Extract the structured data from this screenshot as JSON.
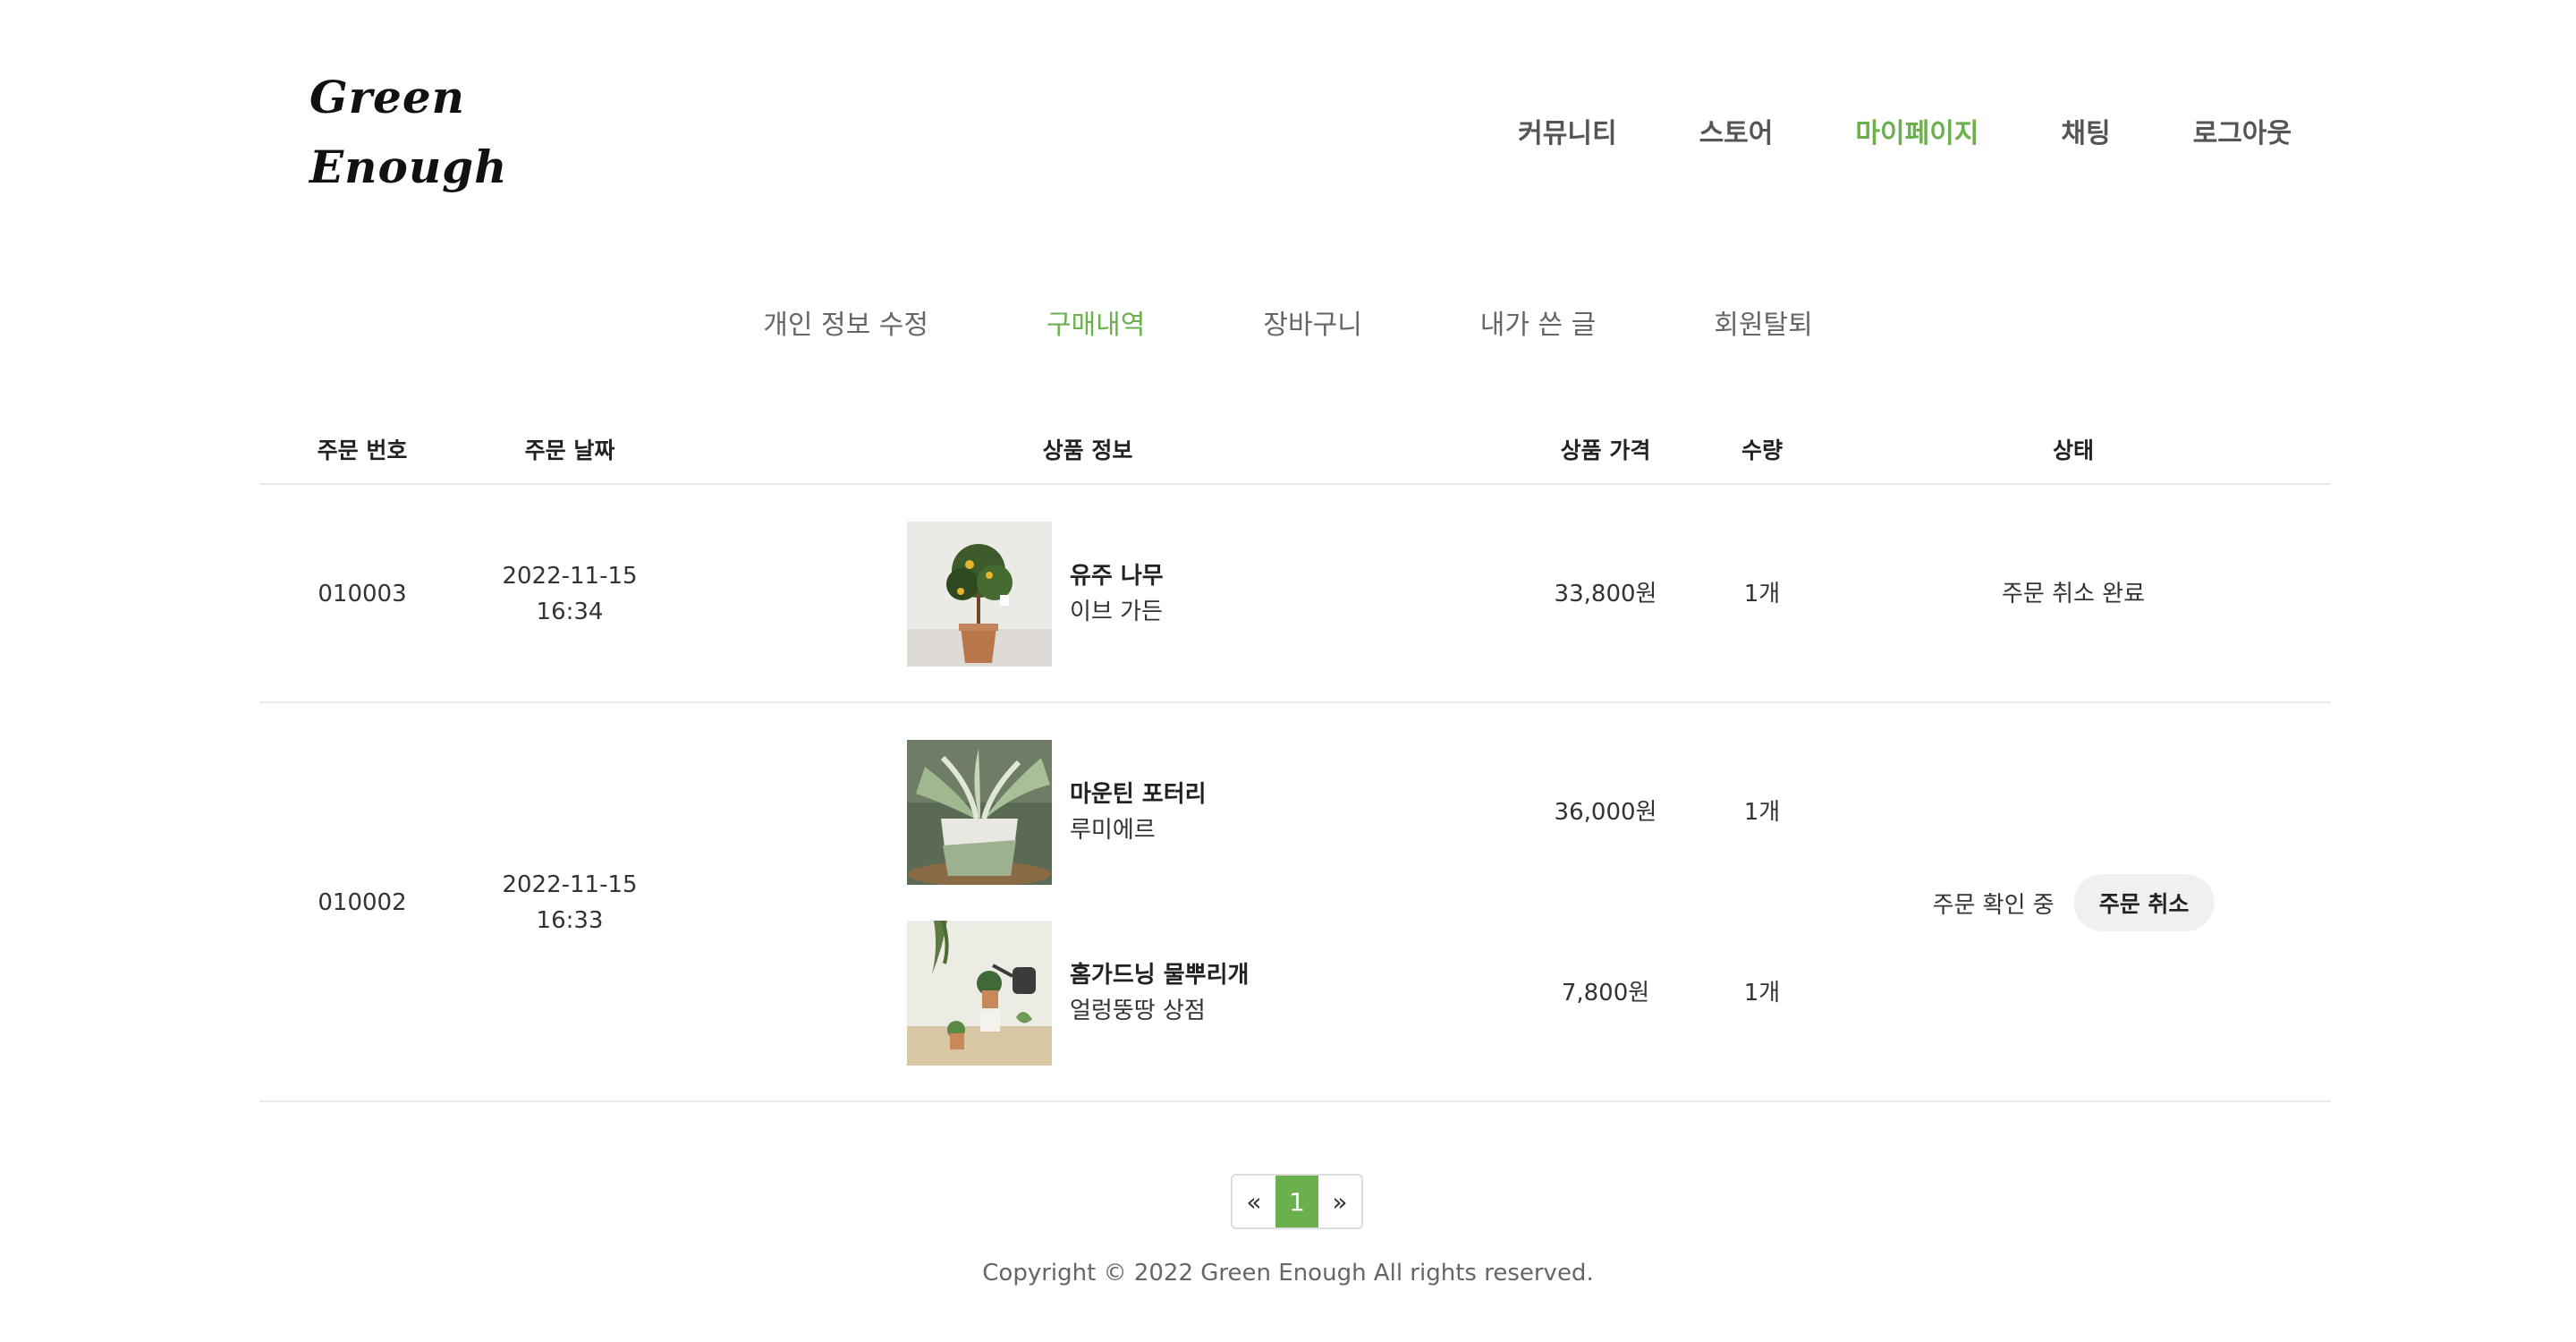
{
  "brand": {
    "line1": "Green",
    "line2": "Enough"
  },
  "main_nav": [
    "커뮤니티",
    "스토어",
    "마이페이지",
    "채팅",
    "로그아웃"
  ],
  "main_nav_active": "마이페이지",
  "sub_nav": [
    "개인 정보 수정",
    "구매내역",
    "장바구니",
    "내가 쓴 글",
    "회원탈퇴"
  ],
  "sub_nav_active": "구매내역",
  "table": {
    "headers": [
      "주문 번호",
      "주문 날짜",
      "상품 정보",
      "상품 가격",
      "수량",
      "상태"
    ],
    "orders": [
      {
        "order_no": "010003",
        "date": "2022-11-15",
        "time": "16:34",
        "items": [
          {
            "name": "유주 나무",
            "seller": "이브 가든",
            "price": "33,800원",
            "qty": "1개"
          }
        ],
        "status": "주문 취소 완료"
      },
      {
        "order_no": "010002",
        "date": "2022-11-15",
        "time": "16:33",
        "items": [
          {
            "name": "마운틴 포터리",
            "seller": "루미에르",
            "price": "36,000원",
            "qty": "1개"
          },
          {
            "name": "홈가드닝 물뿌리개",
            "seller": "얼렁뚱땅 상점",
            "price": "7,800원",
            "qty": "1개"
          }
        ],
        "status": "주문 확인 중",
        "action": "주문 취소"
      }
    ]
  },
  "pagination": {
    "prev": "«",
    "current": "1",
    "next": "»"
  },
  "footer": "Copyright © 2022 Green Enough All rights reserved.",
  "colors": {
    "accent": "#6ab04c",
    "divider": "#e9e9e9",
    "button_bg": "#f0f0f0"
  }
}
